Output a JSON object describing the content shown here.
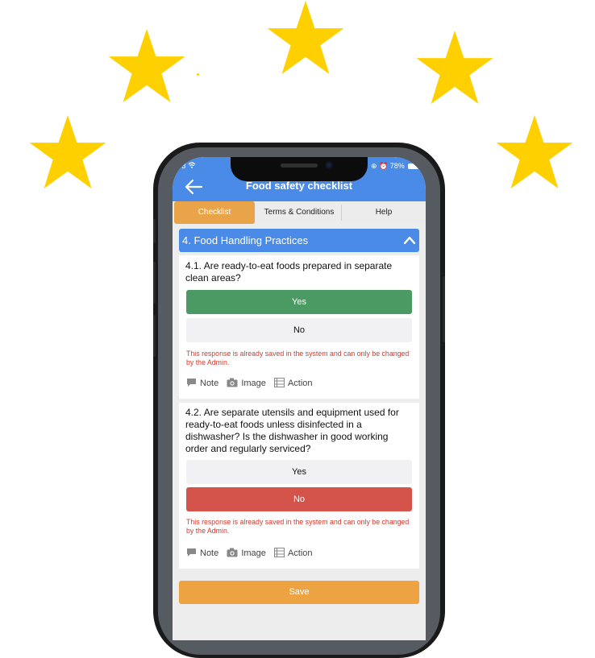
{
  "decorations": {
    "star_color": "#ffd000",
    "star_icon": "star-icon"
  },
  "status_bar": {
    "carrier": "3",
    "battery": "78%"
  },
  "app_bar": {
    "title": "Food safety checklist",
    "back_icon": "back-arrow-icon",
    "color": "#4a8be8"
  },
  "tabs": [
    {
      "label": "Checklist",
      "active": true
    },
    {
      "label": "Terms & Conditions",
      "active": false
    },
    {
      "label": "Help",
      "active": false
    }
  ],
  "section": {
    "title": "4. Food Handling Practices",
    "icon": "chevron-up-icon"
  },
  "questions": [
    {
      "text": "4.1. Are ready-to-eat foods prepared in separate clean areas?",
      "yes_label": "Yes",
      "no_label": "No",
      "selected": "Yes",
      "warning": "This response is already saved in the system and can only be changed by the Admin.",
      "tools": {
        "note": "Note",
        "image": "Image",
        "action": "Action"
      }
    },
    {
      "text": "4.2. Are separate utensils and equipment used for ready-to-eat foods unless disinfected in a dishwasher? Is the dishwasher in good working order and regularly serviced?",
      "yes_label": "Yes",
      "no_label": "No",
      "selected": "No",
      "warning": "This response is already saved in the system and can only be changed by the Admin.",
      "tools": {
        "note": "Note",
        "image": "Image",
        "action": "Action"
      }
    }
  ],
  "save_label": "Save",
  "colors": {
    "accent_orange": "#eda341",
    "yes_green": "#4c9a63",
    "no_red": "#d4534a",
    "warning_red": "#d23a2e"
  }
}
